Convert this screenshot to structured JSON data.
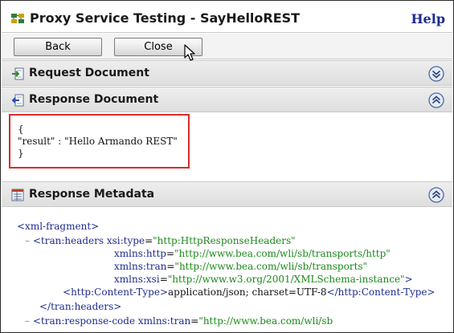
{
  "window": {
    "title": "Proxy Service Testing - SayHelloREST",
    "help_label": "Help"
  },
  "toolbar": {
    "back_label": "Back",
    "close_label": "Close"
  },
  "sections": {
    "request": {
      "title": "Request Document",
      "state": "collapsed"
    },
    "response": {
      "title": "Response Document",
      "state": "expanded"
    },
    "metadata": {
      "title": "Response Metadata",
      "state": "expanded"
    }
  },
  "response_document": {
    "line1": "{",
    "line2": "\"result\" : \"Hello Armando REST\"",
    "line3": "}"
  },
  "metadata": {
    "fragment_open": "<xml-fragment>",
    "headers_open_tag": "tran:headers",
    "xsi_type_attr": "xsi:type",
    "xsi_type_val": "\"http:HttpResponseHeaders\"",
    "ns_http_attr": "xmlns:http",
    "ns_http_val": "\"http://www.bea.com/wli/sb/transports/http\"",
    "ns_tran_attr": "xmlns:tran",
    "ns_tran_val": "\"http://www.bea.com/wli/sb/transports\"",
    "ns_xsi_attr": "xmlns:xsi",
    "ns_xsi_val": "\"http://www.w3.org/2001/XMLSchema-instance\"",
    "content_type_tag": "http:Content-Type",
    "content_type_value": "application/json; charset=UTF-8",
    "headers_close_tag": "tran:headers",
    "response_code_tag": "tran:response-code",
    "response_code_ns_attr": "xmlns:tran",
    "response_code_ns_val": "\"http://www.bea.com/wli/sb"
  },
  "colors": {
    "tag": "#1d2b8f",
    "attribute_value": "#1b8a1b",
    "highlight_border": "#d92b2b",
    "help_link": "#1d2b8f"
  }
}
